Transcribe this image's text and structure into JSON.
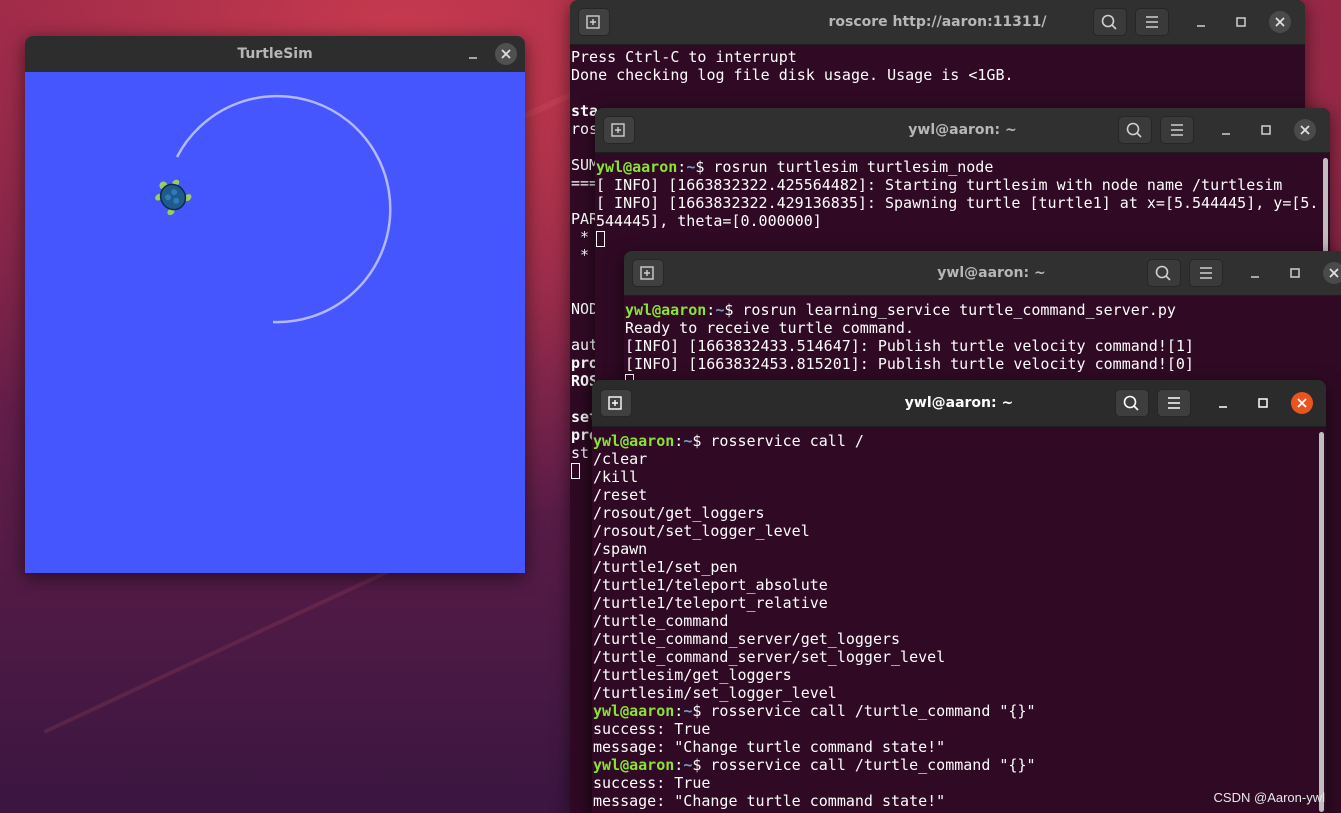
{
  "turtlesim": {
    "title": "TurtleSim"
  },
  "roscore": {
    "title": "roscore http://aaron:11311/",
    "lines": [
      "Press Ctrl-C to interrupt",
      "Done checking log file disk usage. Usage is <1GB.",
      "",
      "sta",
      "ros",
      "",
      "SUM",
      "===",
      "",
      "PAR",
      " *",
      " *",
      "",
      "",
      "NOD",
      "",
      "aut",
      "pro",
      "ROS",
      "",
      "set",
      "pro",
      "st"
    ]
  },
  "term_turtlesim": {
    "title": "ywl@aaron: ~",
    "user": "ywl@aaron",
    "path": "~",
    "command": "rosrun turtlesim turtlesim_node",
    "lines": [
      "[ INFO] [1663832322.425564482]: Starting turtlesim with node name /turtlesim",
      "[ INFO] [1663832322.429136835]: Spawning turtle [turtle1] at x=[5.544445], y=[5.",
      "544445], theta=[0.000000]"
    ]
  },
  "term_server": {
    "title": "ywl@aaron: ~",
    "user": "ywl@aaron",
    "path": "~",
    "command": "rosrun learning_service turtle_command_server.py",
    "lines": [
      "Ready to receive turtle command.",
      "[INFO] [1663832433.514647]: Publish turtle velocity command![1]",
      "[INFO] [1663832453.815201]: Publish turtle velocity command![0]"
    ]
  },
  "term_active": {
    "title": "ywl@aaron: ~",
    "user": "ywl@aaron",
    "path": "~",
    "command1": "rosservice call /",
    "services": [
      "/clear",
      "/kill",
      "/reset",
      "/rosout/get_loggers",
      "/rosout/set_logger_level",
      "/spawn",
      "/turtle1/set_pen",
      "/turtle1/teleport_absolute",
      "/turtle1/teleport_relative",
      "/turtle_command",
      "/turtle_command_server/get_loggers",
      "/turtle_command_server/set_logger_level",
      "/turtlesim/get_loggers",
      "/turtlesim/set_logger_level"
    ],
    "command2": "rosservice call /turtle_command \"{}\"",
    "success": "success: True",
    "message": "message: \"Change turtle command state!\"",
    "command3": "rosservice call /turtle_command \"{}\"",
    "success2": "success: True",
    "message2": "message: \"Change turtle command state!\""
  },
  "watermark": "CSDN @Aaron-ywl",
  "colors": {
    "terminal_bg": "#300a24",
    "prompt_user": "#8ae234",
    "prompt_path": "#729fcf",
    "turtlesim_bg": "#4556ff",
    "close_active": "#e95420"
  }
}
